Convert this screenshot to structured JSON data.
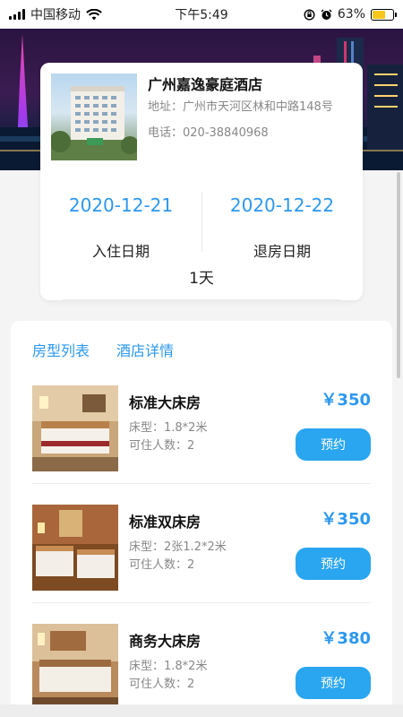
{
  "status_bar": {
    "carrier": "中国移动",
    "time": "下午5:49",
    "battery_pct": "63%",
    "battery_level": 0.63,
    "icons": [
      "signal-icon",
      "wifi-icon",
      "rotation-lock-icon",
      "alarm-icon",
      "battery-icon"
    ]
  },
  "hotel": {
    "name": "广州嘉逸豪庭酒店",
    "address": "地址：广州市天河区林和中路148号",
    "phone": "电话：020-38840968"
  },
  "stay": {
    "checkin_date": "2020-12-21",
    "checkin_label": "入住日期",
    "checkout_date": "2020-12-22",
    "checkout_label": "退房日期",
    "nights": "1天"
  },
  "tabs": [
    "房型列表",
    "酒店详情"
  ],
  "rooms": [
    {
      "name": "标准大床房",
      "bed": "床型：1.8*2米",
      "capacity": "可住人数：2",
      "price": "￥350",
      "book_label": "预约"
    },
    {
      "name": "标准双床房",
      "bed": "床型：2张1.2*2米",
      "capacity": "可住人数：2",
      "price": "￥350",
      "book_label": "预约"
    },
    {
      "name": "商务大床房",
      "bed": "床型：1.8*2米",
      "capacity": "可住人数：2",
      "price": "￥380",
      "book_label": "预约"
    }
  ],
  "colors": {
    "accent": "#2c98f0",
    "button": "#2aa6f0",
    "battery": "#f7c81b"
  }
}
